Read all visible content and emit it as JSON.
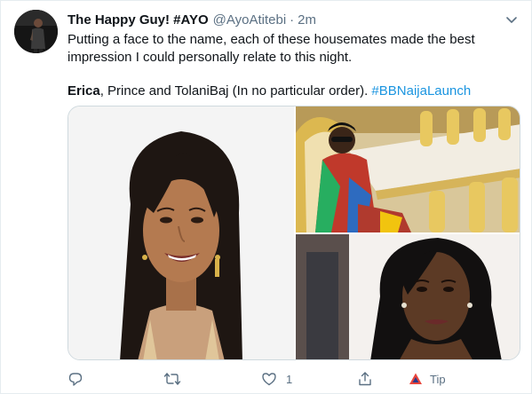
{
  "tweet": {
    "display_name": "The Happy Guy! #AYO",
    "handle": "@AyoAtitebi",
    "separator": "·",
    "time": "2m",
    "text_line1": "Putting a face to the name, each of these housemates made the best",
    "text_line2": "impression I could personally relate to this night.",
    "bold_name": "Erica",
    "text_line3_rest": ", Prince and TolaniBaj (In no particular order). ",
    "hashtag": "#BBNaijaLaunch"
  },
  "actions": {
    "reply_icon": "reply-icon",
    "retweet_icon": "retweet-icon",
    "like_icon": "heart-icon",
    "like_count": "1",
    "share_icon": "share-icon",
    "tip_icon": "tip-icon",
    "tip_label": "Tip"
  },
  "colors": {
    "text": "#0f1419",
    "muted": "#5b7083",
    "link": "#1b95e0",
    "tip_red": "#e8453c"
  }
}
